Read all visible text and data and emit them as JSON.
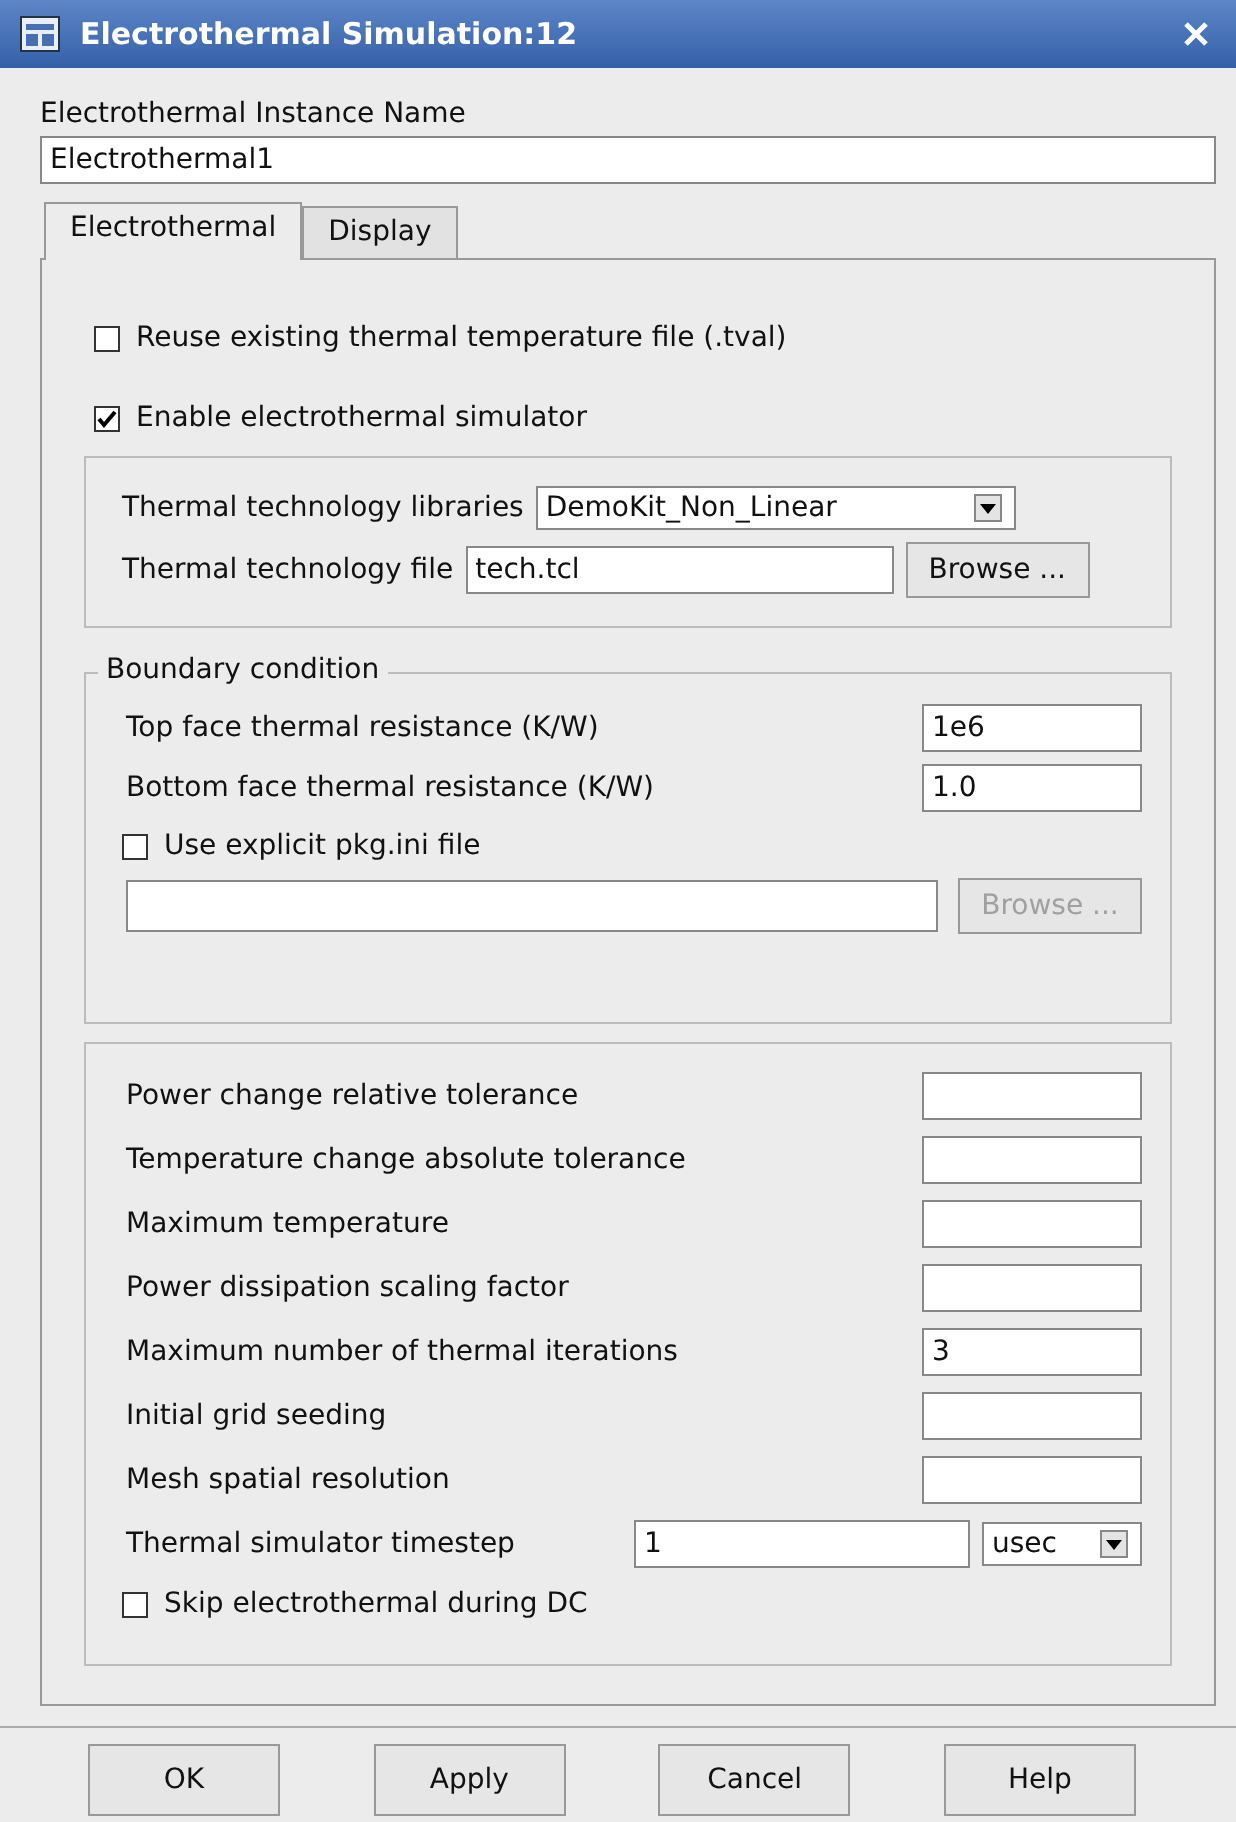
{
  "window": {
    "title": "Electrothermal Simulation:12"
  },
  "instance_name": {
    "label": "Electrothermal Instance Name",
    "value": "Electrothermal1"
  },
  "tabs": [
    {
      "label": "Electrothermal",
      "selected": true
    },
    {
      "label": "Display",
      "selected": false
    }
  ],
  "options": [
    {
      "label": "Reuse existing thermal temperature file (.tval)",
      "checked": false
    },
    {
      "label": "Enable electrothermal simulator",
      "checked": true
    }
  ],
  "technology": {
    "libraries_label": "Thermal technology libraries",
    "libraries_value": "DemoKit_Non_Linear",
    "file_label": "Thermal technology file",
    "file_value": "tech.tcl",
    "browse": {
      "label": "Browse ...",
      "disabled": false
    }
  },
  "boundary": {
    "title": "Boundary condition",
    "fields": [
      {
        "label": "Top face thermal resistance (K/W)",
        "value": "1e6"
      },
      {
        "label": "Bottom face thermal resistance (K/W)",
        "value": "1.0"
      }
    ],
    "pkg": {
      "label": "Use explicit pkg.ini file",
      "checked": false
    },
    "pkg_browse": {
      "label": "Browse ...",
      "disabled": true
    }
  },
  "parameters": {
    "rows": [
      {
        "kind": "field",
        "label": "Power change relative tolerance"
      },
      {
        "kind": "field",
        "label": "Temperature change absolute tolerance"
      },
      {
        "kind": "field",
        "label": "Maximum temperature"
      },
      {
        "kind": "field",
        "label": "Power dissipation scaling factor"
      },
      {
        "kind": "field",
        "label": "Maximum number of thermal iterations",
        "value": "3"
      },
      {
        "kind": "field",
        "label": "Initial grid seeding"
      },
      {
        "kind": "field",
        "label": "Mesh spatial resolution"
      },
      {
        "kind": "timestep",
        "label": "Thermal simulator timestep",
        "value": "1",
        "unit": "usec"
      },
      {
        "kind": "checkbox",
        "label": "Skip electrothermal during DC",
        "checked": false
      }
    ]
  },
  "buttons": [
    "OK",
    "Apply",
    "Cancel",
    "Help"
  ]
}
